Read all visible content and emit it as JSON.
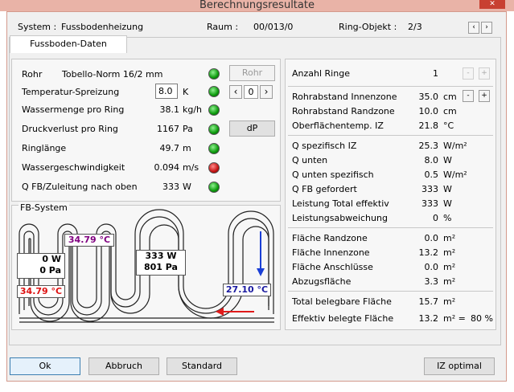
{
  "window": {
    "title": "Berechnungsresultate",
    "close": "✕"
  },
  "header": {
    "system_label": "System :",
    "system_value": "Fussbodenheizung",
    "raum_label": "Raum :",
    "raum_value": "00/013/0",
    "ring_label": "Ring-Objekt :",
    "ring_value": "2/3"
  },
  "tab": {
    "label": "Fussboden-Daten"
  },
  "left": {
    "rows": [
      {
        "label": "Rohr",
        "value": "Tobello-Norm 16/2 mm",
        "led": "green"
      },
      {
        "label": "Temperatur-Spreizung",
        "value": "8.0",
        "unit": "K",
        "led": "green"
      },
      {
        "label": "Wassermenge pro Ring",
        "value": "38.1",
        "unit": "kg/h",
        "led": "green"
      },
      {
        "label": "Druckverlust pro Ring",
        "value": "1167",
        "unit": "Pa",
        "led": "green"
      },
      {
        "label": "Ringlänge",
        "value": "49.7",
        "unit": "m",
        "led": "green"
      },
      {
        "label": "Wassergeschwindigkeit",
        "value": "0.094",
        "unit": "m/s",
        "led": "red"
      },
      {
        "label": "Q FB/Zuleitung nach oben",
        "value": "333",
        "unit": "W",
        "led": "green"
      }
    ],
    "rohr_button": "Rohr",
    "spin_value": "0",
    "dp_button": "dP"
  },
  "fb_system": {
    "title": "FB-System",
    "temp_top": "34.79 °C",
    "temp_left": "34.79 °C",
    "temp_right": "27.10 °C",
    "box_left_line1": "0 W",
    "box_left_line2": "0 Pa",
    "box_mid_line1": "333 W",
    "box_mid_line2": "801 Pa",
    "colors": {
      "temp_top": "#800080",
      "temp_left": "#dd1111",
      "temp_right": "#1a1aa0",
      "arrow_down": "#1a3fd6",
      "arrow_left": "#e01a1a"
    }
  },
  "right": {
    "anzahl": {
      "label": "Anzahl Ringe",
      "value": "1",
      "minus": "-",
      "plus": "+"
    },
    "rows": [
      {
        "label": "Rohrabstand Innenzone",
        "value": "35.0",
        "unit": "cm"
      },
      {
        "label": "Rohrabstand Randzone",
        "value": "10.0",
        "unit": "cm"
      },
      {
        "label": "Oberflächentemp. IZ",
        "value": "21.8",
        "unit": "°C"
      },
      {
        "label": "Q spezifisch IZ",
        "value": "25.3",
        "unit": "W/m²"
      },
      {
        "label": "Q unten",
        "value": "8.0",
        "unit": "W"
      },
      {
        "label": "Q unten spezifisch",
        "value": "0.5",
        "unit": "W/m²"
      },
      {
        "label": "Q FB gefordert",
        "value": "333",
        "unit": "W"
      },
      {
        "label": "Leistung Total effektiv",
        "value": "333",
        "unit": "W"
      },
      {
        "label": "Leistungsabweichung",
        "value": "0",
        "unit": "%"
      },
      {
        "label": "Fläche Randzone",
        "value": "0.0",
        "unit": "m²"
      },
      {
        "label": "Fläche Innenzone",
        "value": "13.2",
        "unit": "m²"
      },
      {
        "label": "Fläche Anschlüsse",
        "value": "0.0",
        "unit": "m²"
      },
      {
        "label": "Abzugsfläche",
        "value": "3.3",
        "unit": "m²"
      },
      {
        "label": "Total belegbare Fläche",
        "value": "15.7",
        "unit": "m²"
      },
      {
        "label": "Effektiv belegte Fläche",
        "value": "13.2",
        "unit": "m² =",
        "extra": "80 %"
      }
    ],
    "innen_minus": "-",
    "innen_plus": "+"
  },
  "footer": {
    "ok": "Ok",
    "abbruch": "Abbruch",
    "standard": "Standard",
    "iz_optimal": "IZ optimal"
  }
}
